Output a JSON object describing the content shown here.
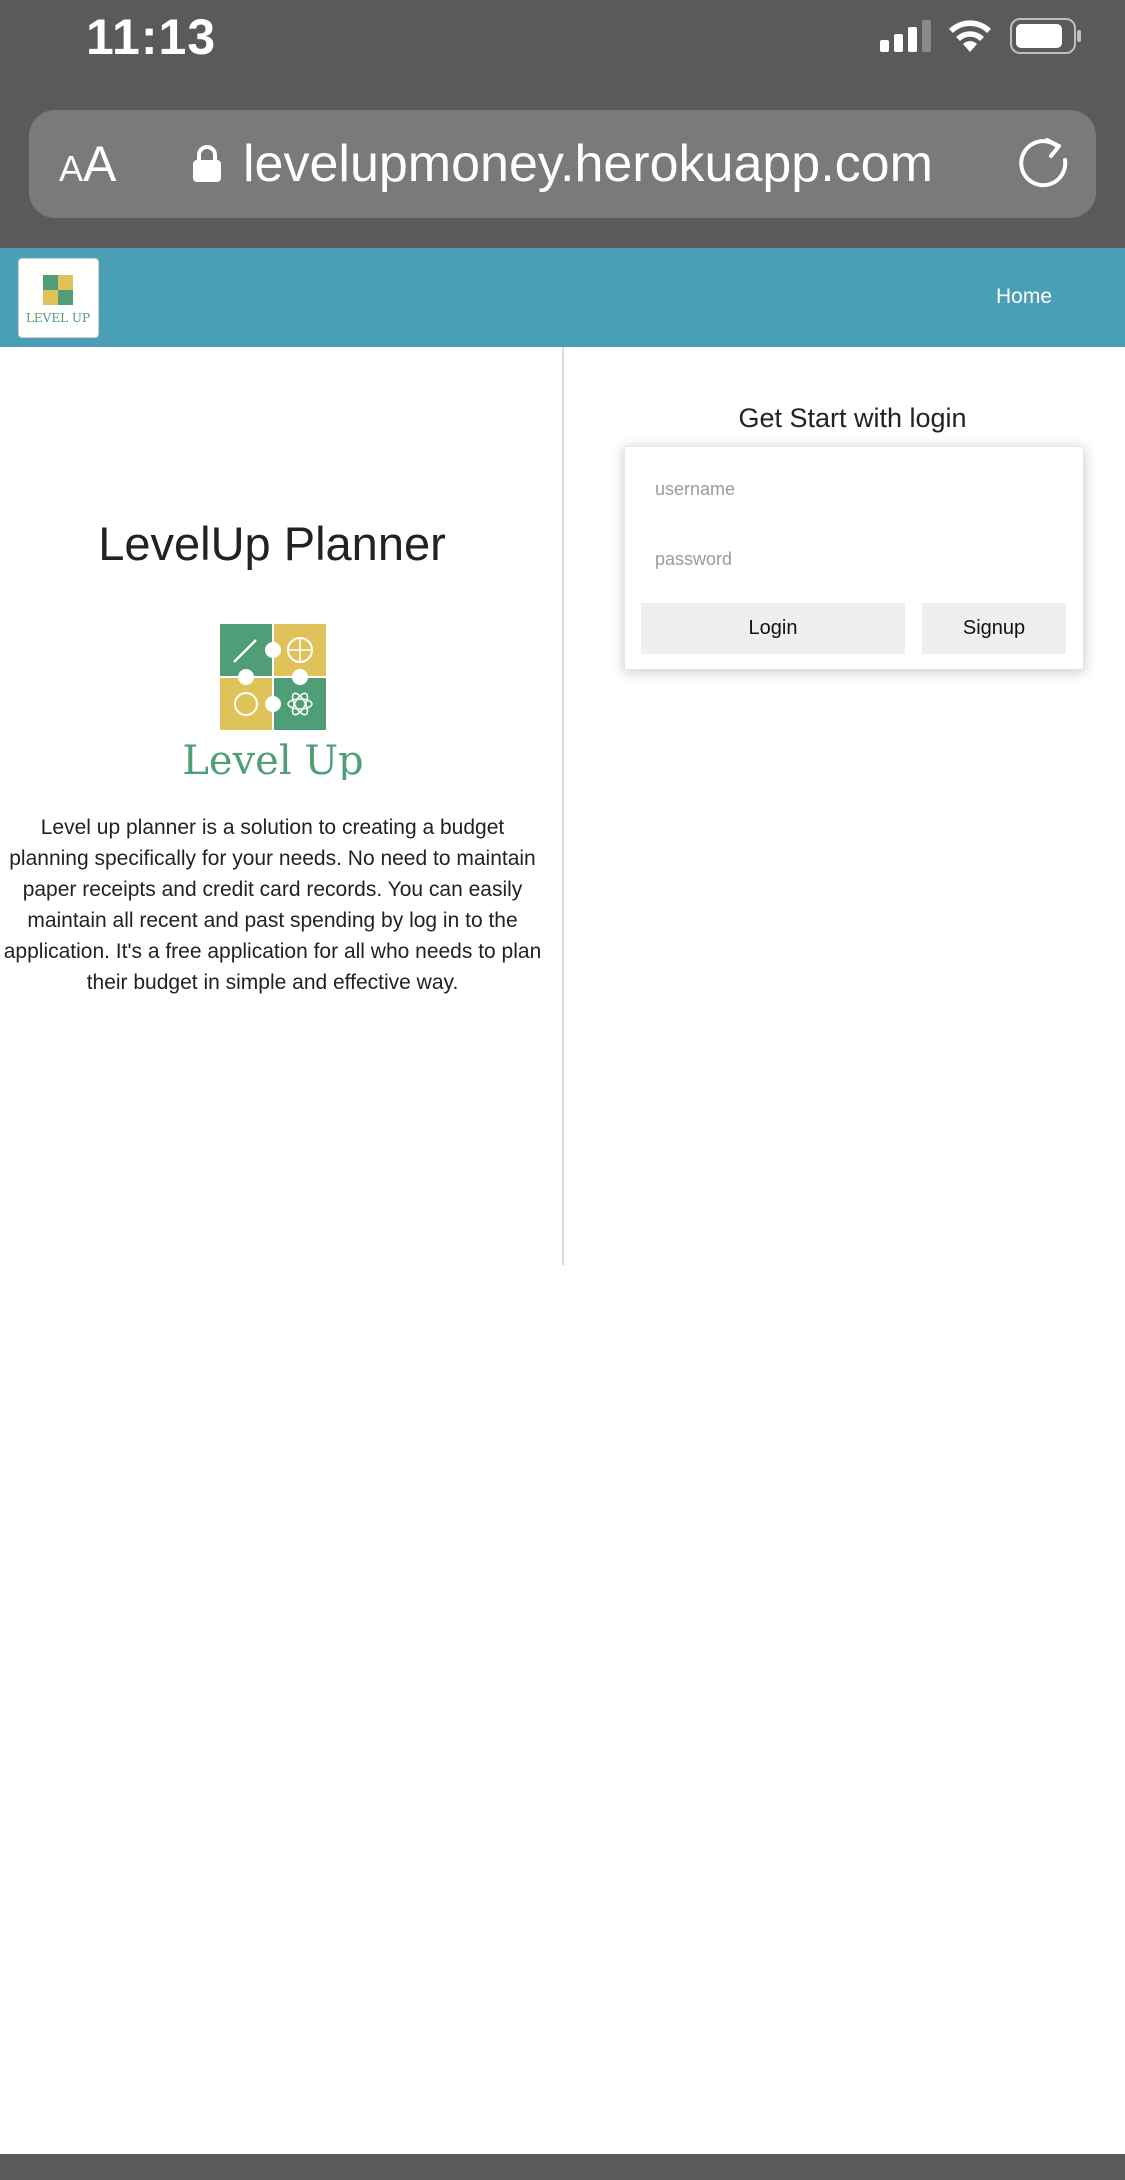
{
  "status_bar": {
    "time": "11:13"
  },
  "browser": {
    "text_size_label": "AA",
    "url": "levelupmoney.herokuapp.com"
  },
  "nav": {
    "home_label": "Home"
  },
  "left": {
    "title": "LevelUp Planner",
    "logo_text": "Level Up",
    "description": "Level up planner is a solution to creating a budget planning specifically for your needs. No need to maintain paper receipts and credit card records. You can easily maintain all recent and past spending by log in to the application. It's a free application for all who needs to plan their budget in simple and effective way."
  },
  "login": {
    "heading": "Get Start with login",
    "username_placeholder": "username",
    "password_placeholder": "password",
    "login_label": "Login",
    "signup_label": "Signup"
  },
  "colors": {
    "navbar": "#4a9eb5",
    "logo_green": "#4f9e78",
    "logo_yellow": "#e0c25a"
  }
}
